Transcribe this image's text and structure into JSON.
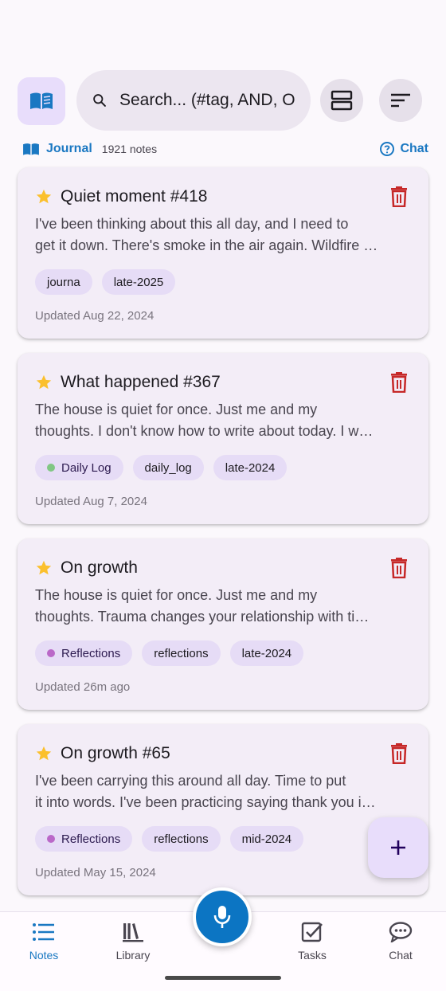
{
  "search": {
    "placeholder": "Search... (#tag, AND, O"
  },
  "journal": {
    "name": "Journal",
    "count": "1921 notes",
    "chat_label": "Chat"
  },
  "colors": {
    "accent": "#1a78c2",
    "star": "#fbc02d",
    "delete": "#c62828",
    "daily_log_dot": "#81c784",
    "reflections_dot": "#ba68c8"
  },
  "notes": [
    {
      "title": "Quiet moment #418",
      "line1": "I've been thinking about this all day, and I need to",
      "line2": "get it down. There's smoke in the air again. Wildfire …",
      "tags": [
        "journa",
        "late-2025"
      ],
      "updated": "Updated Aug 22, 2024"
    },
    {
      "title": "What happened #367",
      "line1": "The house is quiet for once. Just me and my",
      "line2": "thoughts. I don't know how to write about today. I w…",
      "category": "Daily Log",
      "tags": [
        "daily_log",
        "late-2024"
      ],
      "updated": "Updated Aug 7, 2024"
    },
    {
      "title": "On growth",
      "line1": "The house is quiet for once. Just me and my",
      "line2": "thoughts. Trauma changes your relationship with ti…",
      "category": "Reflections",
      "tags": [
        "reflections",
        "late-2024"
      ],
      "updated": "Updated 26m ago"
    },
    {
      "title": "On growth #65",
      "line1": "I've been carrying this around all day. Time to put",
      "line2": "it into words. I've been practicing saying thank you i…",
      "category": "Reflections",
      "tags": [
        "reflections",
        "mid-2024"
      ],
      "updated": "Updated May 15, 2024"
    }
  ],
  "nav": {
    "notes": "Notes",
    "library": "Library",
    "tasks": "Tasks",
    "chat": "Chat"
  }
}
